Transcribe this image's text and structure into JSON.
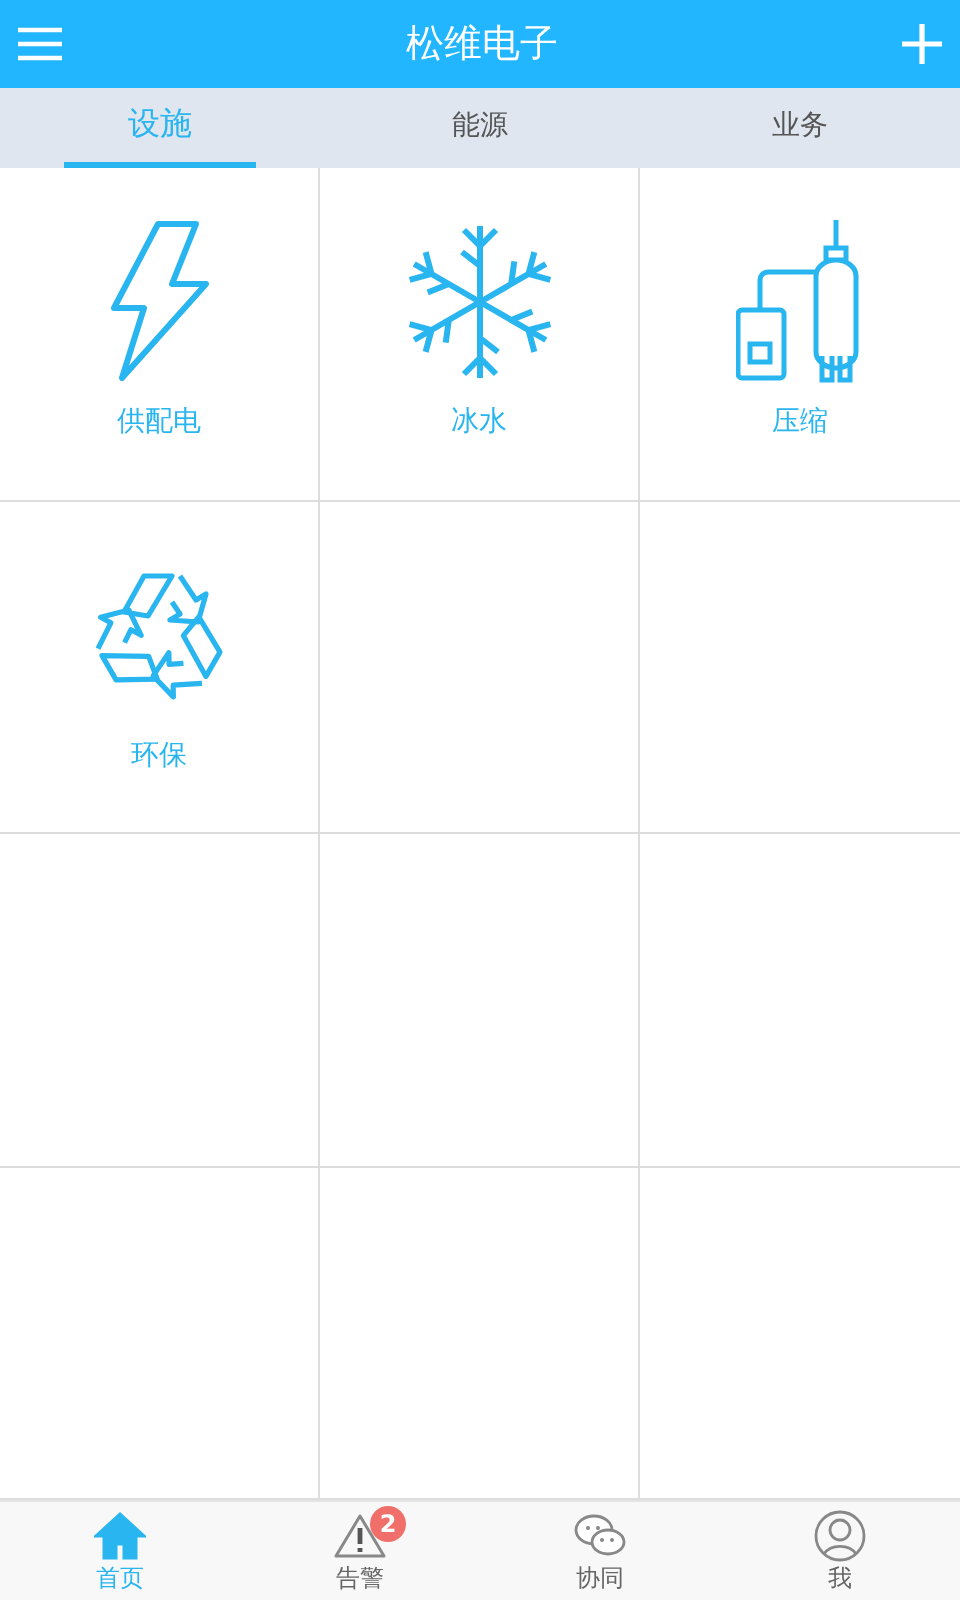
{
  "header": {
    "title": "松维电子"
  },
  "tabs": [
    {
      "label": "设施",
      "selected": true
    },
    {
      "label": "能源",
      "selected": false
    },
    {
      "label": "业务",
      "selected": false
    }
  ],
  "tiles": [
    {
      "kind": "power",
      "label": "供配电"
    },
    {
      "kind": "snow",
      "label": "冰水"
    },
    {
      "kind": "compressor",
      "label": "压缩"
    },
    {
      "kind": "recycle",
      "label": "环保"
    }
  ],
  "nav": [
    {
      "kind": "home",
      "label": "首页",
      "selected": true
    },
    {
      "kind": "alarm",
      "label": "告警",
      "selected": false,
      "badge": "2"
    },
    {
      "kind": "chat",
      "label": "协同",
      "selected": false
    },
    {
      "kind": "user",
      "label": "我",
      "selected": false
    }
  ]
}
